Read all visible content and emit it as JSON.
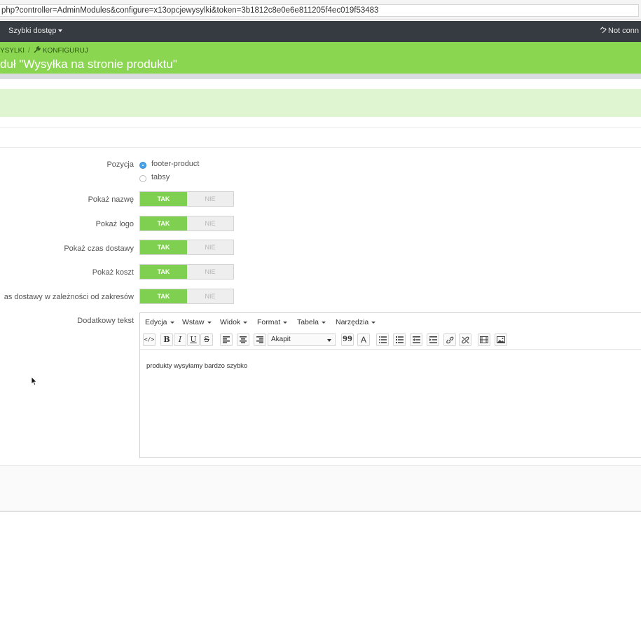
{
  "browser": {
    "url": "php?controller=AdminModules&configure=x13opcjewysylki&token=3b1812c8e0e6e811205f4ec019f53483"
  },
  "topnav": {
    "quick_access": "Szybki dostęp",
    "connection": "Not conn"
  },
  "header": {
    "breadcrumb_parent": "YSYLKI",
    "breadcrumb_current": "KONFIGURUJ",
    "title": "duł \"Wysyłka na stronie produktu\""
  },
  "form": {
    "position_label": "Pozycja",
    "position_options": [
      "footer-product",
      "tabsy"
    ],
    "position_selected": "footer-product",
    "toggle_yes": "TAK",
    "toggle_no": "NIE",
    "toggles": [
      {
        "label": "Pokaż nazwę",
        "value": "TAK"
      },
      {
        "label": "Pokaż logo",
        "value": "TAK"
      },
      {
        "label": "Pokaż czas dostawy",
        "value": "TAK"
      },
      {
        "label": "Pokaż koszt",
        "value": "TAK"
      },
      {
        "label": "as dostawy w zależności od zakresów",
        "value": "TAK"
      }
    ],
    "extra_text_label": "Dodatkowy tekst"
  },
  "editor": {
    "menu": [
      "Edycja",
      "Wstaw",
      "Widok",
      "Format",
      "Tabela",
      "Narzędzia"
    ],
    "format_select": "Akapit",
    "content": "produkty wysyłamy bardzo szybko",
    "toolbar_icons": [
      "source-code-icon",
      "bold-icon",
      "italic-icon",
      "underline-icon",
      "strikethrough-icon",
      "align-left-icon",
      "align-center-icon",
      "align-right-icon",
      "blockquote-icon",
      "text-color-icon",
      "bullet-list-icon",
      "numbered-list-icon",
      "outdent-icon",
      "indent-icon",
      "link-icon",
      "unlink-icon",
      "media-icon",
      "image-icon"
    ],
    "toolbar_glyphs": {
      "bold": "B",
      "italic": "I",
      "underline": "U",
      "strike": "S",
      "quote": "99",
      "color": "A"
    }
  }
}
